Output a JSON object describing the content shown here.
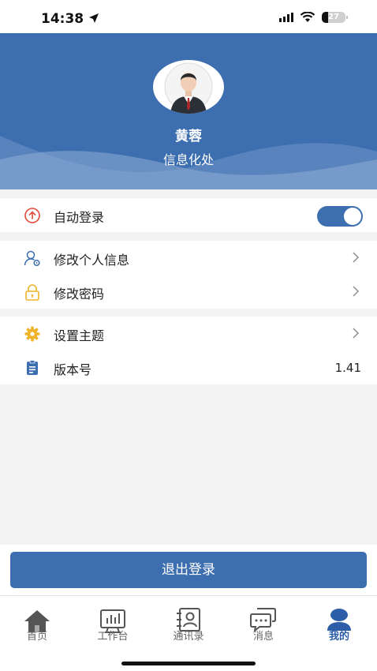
{
  "status_bar": {
    "time": "14:38",
    "battery": "27"
  },
  "profile": {
    "name": "黄蓉",
    "department": "信息化处"
  },
  "settings": {
    "auto_login": {
      "label": "自动登录",
      "enabled": true,
      "icon": "upload-circle-icon"
    },
    "account": [
      {
        "label": "修改个人信息",
        "icon": "user-settings-icon"
      },
      {
        "label": "修改密码",
        "icon": "lock-icon"
      }
    ],
    "app": [
      {
        "label": "设置主题",
        "icon": "gear-icon"
      },
      {
        "label": "版本号",
        "value": "1.41",
        "icon": "clipboard-icon"
      }
    ]
  },
  "logout_label": "退出登录",
  "tabs": [
    {
      "label": "首页",
      "icon": "home-icon",
      "active": false
    },
    {
      "label": "工作台",
      "icon": "workbench-icon",
      "active": false
    },
    {
      "label": "通讯录",
      "icon": "contacts-icon",
      "active": false
    },
    {
      "label": "消息",
      "icon": "chat-icon",
      "active": false
    },
    {
      "label": "我的",
      "icon": "profile-icon",
      "active": true
    }
  ],
  "colors": {
    "primary": "#3d6fb0",
    "background": "#f3f3f3"
  }
}
